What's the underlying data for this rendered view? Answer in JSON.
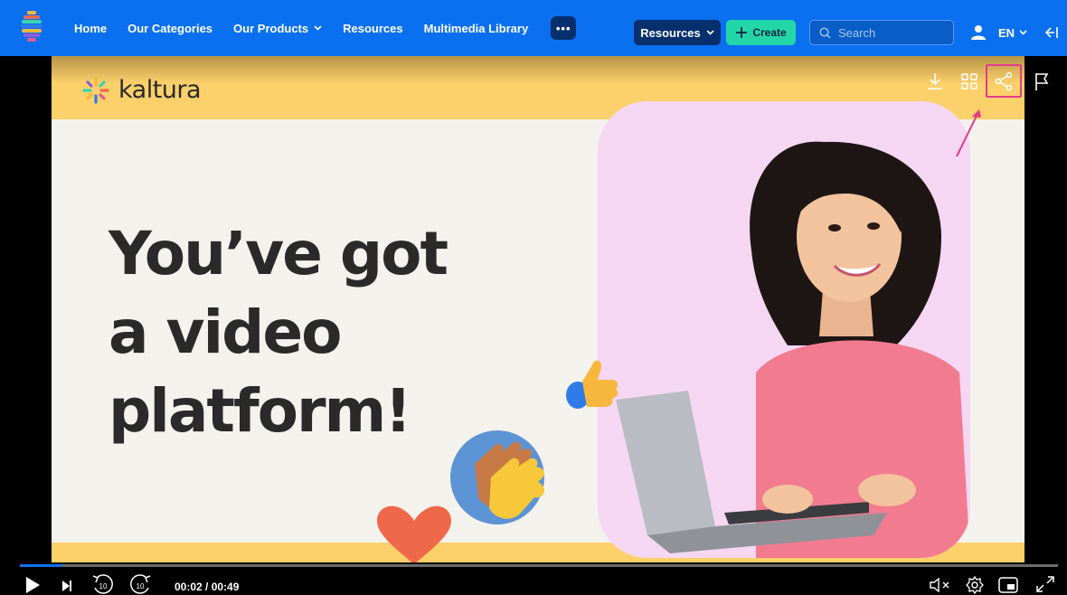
{
  "header": {
    "logo_icon": "kaltura-tower-logo-icon",
    "nav": [
      {
        "label": "Home",
        "dropdown": false
      },
      {
        "label": "Our Categories",
        "dropdown": false
      },
      {
        "label": "Our Products",
        "dropdown": true
      },
      {
        "label": "Resources",
        "dropdown": false
      },
      {
        "label": "Multimedia Library",
        "dropdown": false
      }
    ],
    "more_label": "•••",
    "resources_button": "Resources",
    "create_button": "Create",
    "search_placeholder": "Search",
    "language": "EN",
    "colors": {
      "bar": "#0a70f0",
      "dark_button": "#062f6e",
      "create": "#23d6a8"
    }
  },
  "video": {
    "brand": "kaltura",
    "headline_lines": [
      "You’ve got",
      "a video",
      "platform!"
    ],
    "overlay_icons": [
      "download-icon",
      "grid-icon",
      "share-icon",
      "flag-icon"
    ],
    "highlight_color": "#e43b8a"
  },
  "player": {
    "current_time": "00:02",
    "duration": "00:49",
    "time_display": "00:02 / 00:49",
    "progress_fraction": 0.041,
    "skip_back_label": "10",
    "skip_forward_label": "10",
    "controls_icons": [
      "play-icon",
      "next-icon",
      "rewind-10-icon",
      "forward-10-icon",
      "mute-icon",
      "settings-icon",
      "pip-icon",
      "fullscreen-icon"
    ]
  }
}
